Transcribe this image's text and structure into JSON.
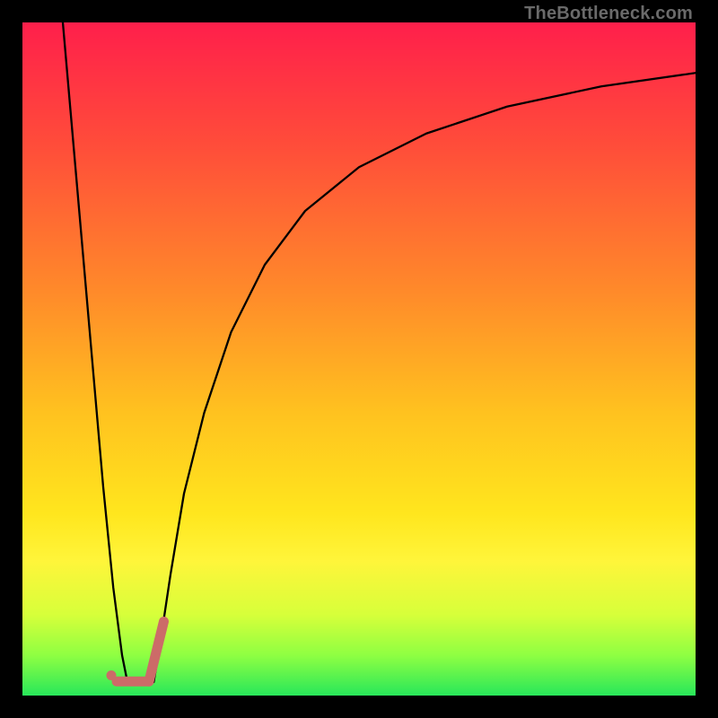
{
  "watermark": "TheBottleneck.com",
  "chart_data": {
    "type": "line",
    "title": "",
    "xlabel": "",
    "ylabel": "",
    "xlim": [
      0,
      100
    ],
    "ylim": [
      0,
      100
    ],
    "grid": false,
    "legend": false,
    "gradient_stops": [
      {
        "offset": 0,
        "color": "#ff1f4b"
      },
      {
        "offset": 18,
        "color": "#ff4c3a"
      },
      {
        "offset": 40,
        "color": "#ff8a2a"
      },
      {
        "offset": 58,
        "color": "#ffc21f"
      },
      {
        "offset": 73,
        "color": "#ffe61e"
      },
      {
        "offset": 80,
        "color": "#fff53a"
      },
      {
        "offset": 88,
        "color": "#d7ff3a"
      },
      {
        "offset": 94,
        "color": "#8fff42"
      },
      {
        "offset": 100,
        "color": "#28e75a"
      }
    ],
    "series": [
      {
        "name": "left-branch",
        "stroke": "#000000",
        "stroke_width": 2.3,
        "x": [
          6.0,
          8.0,
          10.0,
          12.0,
          13.5,
          14.8,
          15.6
        ],
        "y": [
          100.0,
          77.0,
          54.0,
          31.0,
          16.0,
          6.0,
          2.0
        ]
      },
      {
        "name": "right-branch",
        "stroke": "#000000",
        "stroke_width": 2.3,
        "x": [
          19.5,
          20.5,
          22.0,
          24.0,
          27.0,
          31.0,
          36.0,
          42.0,
          50.0,
          60.0,
          72.0,
          86.0,
          100.0
        ],
        "y": [
          2.0,
          8.0,
          18.0,
          30.0,
          42.0,
          54.0,
          64.0,
          72.0,
          78.5,
          83.5,
          87.5,
          90.5,
          92.5
        ]
      },
      {
        "name": "valley-marker",
        "type": "marker",
        "stroke": "#cc6b68",
        "stroke_width": 11,
        "cap": "round",
        "points": [
          {
            "kind": "dot",
            "x": 13.2,
            "y": 3.0,
            "r": 5.5
          },
          {
            "kind": "line",
            "x1": 14.0,
            "y1": 2.1,
            "x2": 18.8,
            "y2": 2.1
          },
          {
            "kind": "line",
            "x1": 18.8,
            "y1": 2.1,
            "x2": 21.0,
            "y2": 11.0
          }
        ]
      }
    ]
  }
}
